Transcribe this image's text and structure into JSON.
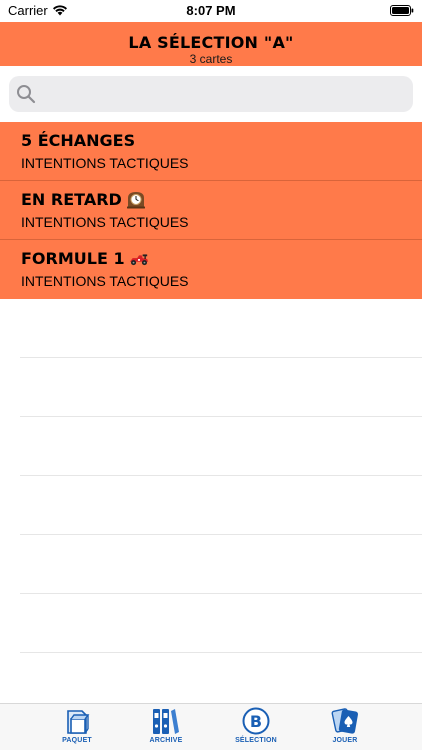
{
  "status_bar": {
    "carrier": "Carrier",
    "time": "8:07 PM"
  },
  "header": {
    "title": "LA SÉLECTION \"A\"",
    "subtitle": "3 cartes"
  },
  "search": {
    "placeholder": "",
    "value": ""
  },
  "cards": [
    {
      "title": "5 ÉCHANGES",
      "subtitle": "INTENTIONS TACTIQUES",
      "icon": ""
    },
    {
      "title": "EN RETARD",
      "subtitle": "INTENTIONS TACTIQUES",
      "icon": "mantel-clock-icon"
    },
    {
      "title": "FORMULE 1",
      "subtitle": "INTENTIONS TACTIQUES",
      "icon": "race-car-icon"
    }
  ],
  "tabs": [
    {
      "label": "PAQUET",
      "icon": "box-icon"
    },
    {
      "label": "ARCHIVE",
      "icon": "binders-icon"
    },
    {
      "label": "SÉLECTION",
      "icon": "b-circle-icon"
    },
    {
      "label": "JOUER",
      "icon": "playing-cards-icon"
    }
  ],
  "colors": {
    "accent": "#FF7A4A",
    "tab_tint": "#1A5FB4"
  }
}
